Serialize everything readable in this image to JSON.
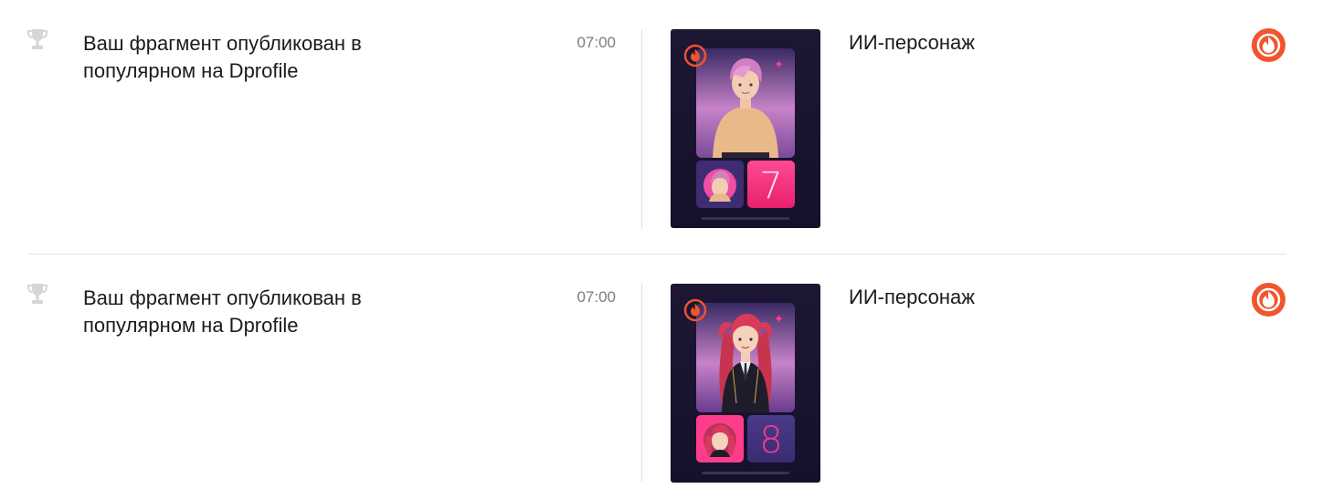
{
  "notifications": [
    {
      "message": "Ваш фрагмент опубликован в популярном на Dprofile",
      "time": "07:00",
      "title": "ИИ-персонаж",
      "card": {
        "number": "7",
        "character": "pink-haired-young-man-in-sweater"
      }
    },
    {
      "message": "Ваш фрагмент опубликован в популярном на Dprofile",
      "time": "07:00",
      "title": "ИИ-персонаж",
      "card": {
        "number": "8",
        "character": "red-haired-girl-in-school-uniform"
      }
    }
  ],
  "icons": {
    "category": "trophy-icon",
    "brand": "dprofile-flame-logo-icon"
  },
  "colors": {
    "brand": "#f2542d",
    "icon_muted": "#d6d6d6",
    "time": "#7c7c7c",
    "divider": "#e3e3e3",
    "accent_pink": "#ff2d86"
  }
}
